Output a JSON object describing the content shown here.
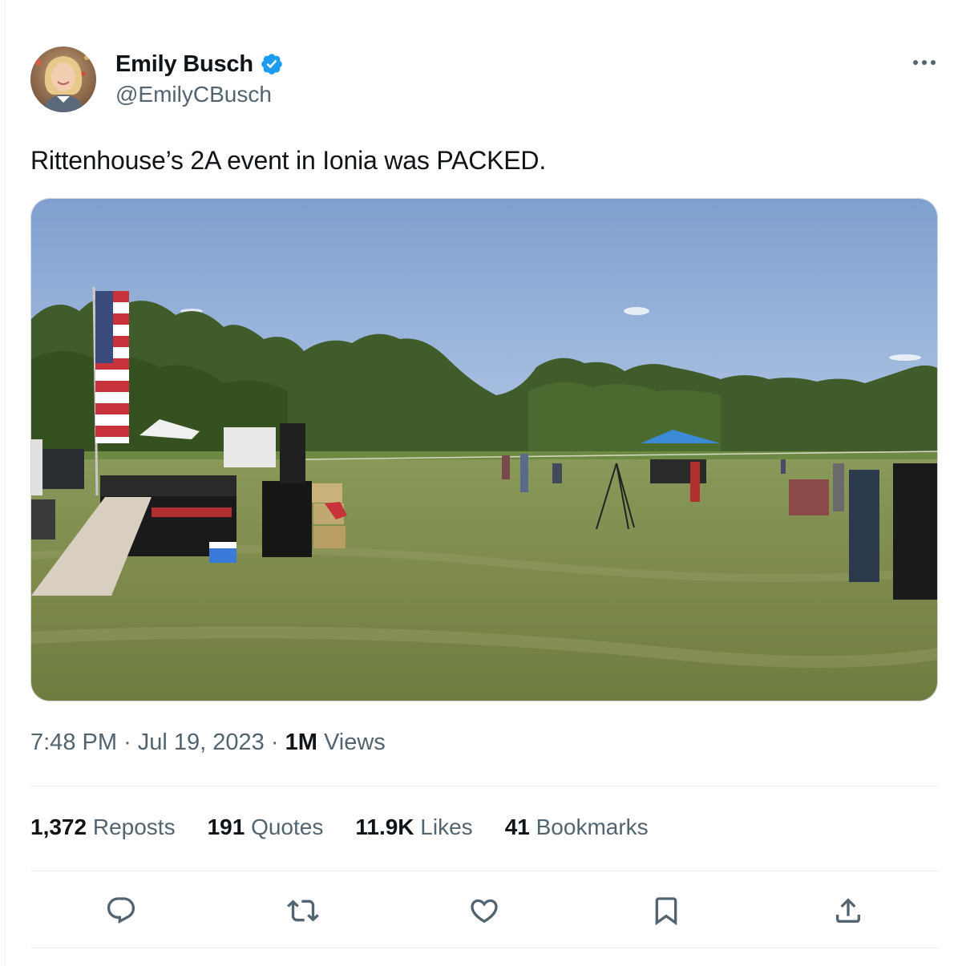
{
  "author": {
    "display_name": "Emily Busch",
    "handle": "@EmilyCBusch",
    "verified": true
  },
  "tweet": {
    "text": "Rittenhouse’s 2A event in Ionia was PACKED."
  },
  "meta": {
    "time": "7:48 PM",
    "separator": "·",
    "date": "Jul 19, 2023",
    "views_count": "1M",
    "views_label": " Views"
  },
  "stats": [
    {
      "count": "1,372",
      "label": " Reposts"
    },
    {
      "count": "191",
      "label": " Quotes"
    },
    {
      "count": "11.9K",
      "label": " Likes"
    },
    {
      "count": "41",
      "label": " Bookmarks"
    }
  ],
  "icons": {
    "verified": "verified-badge-icon",
    "more": "more-dots-icon",
    "reply": "reply-icon",
    "repost": "repost-icon",
    "like": "heart-icon",
    "bookmark": "bookmark-icon",
    "share": "share-icon"
  },
  "colors": {
    "verified_blue": "#1d9bf0",
    "secondary_text": "#536471",
    "primary_text": "#0f1419"
  }
}
